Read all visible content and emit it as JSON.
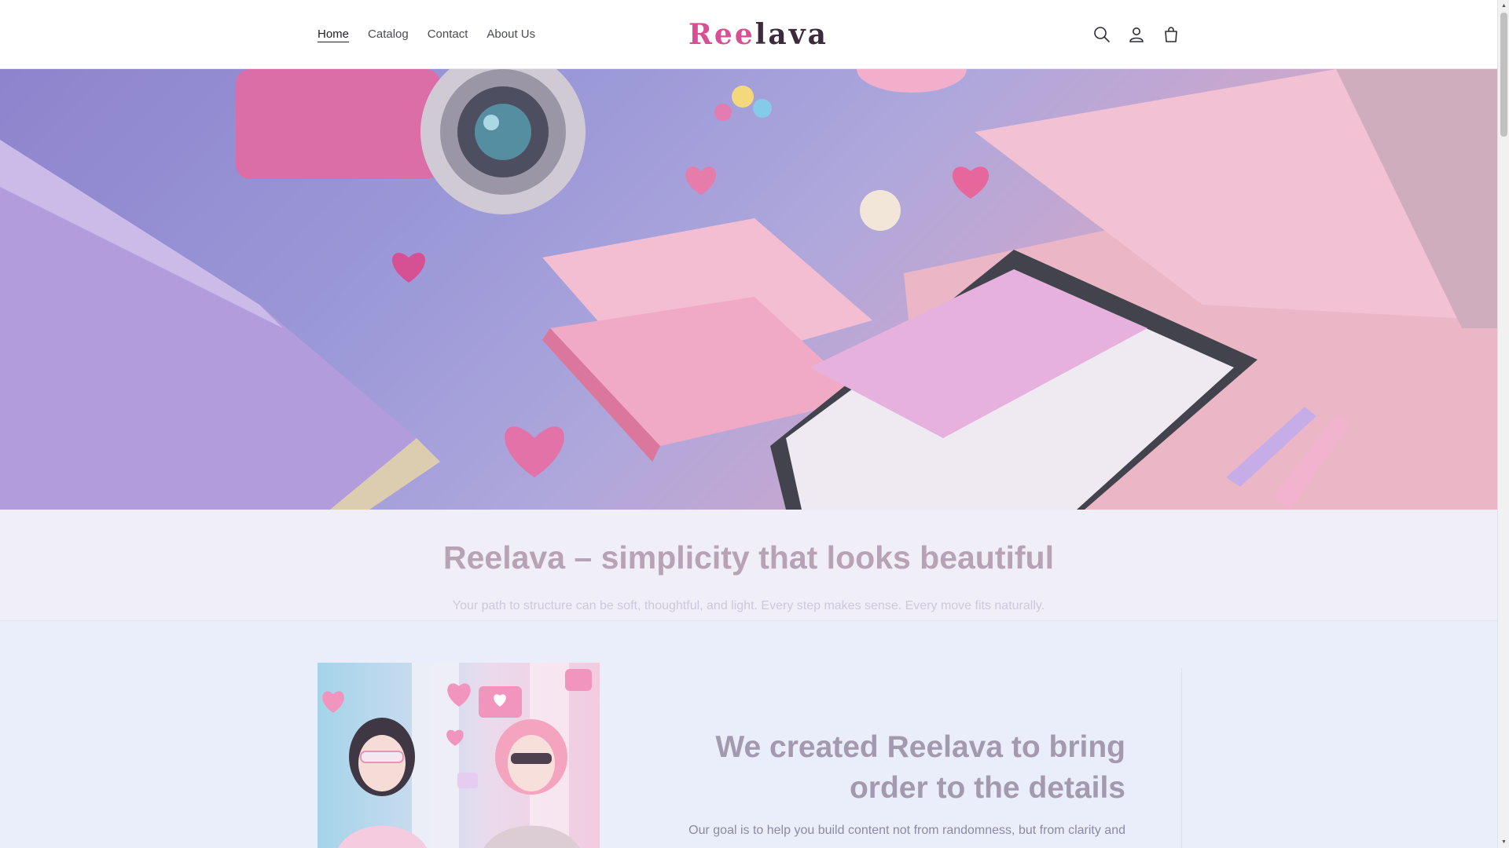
{
  "header": {
    "nav": [
      {
        "label": "Home",
        "active": true
      },
      {
        "label": "Catalog"
      },
      {
        "label": "Contact"
      },
      {
        "label": "About Us"
      }
    ],
    "logo_first": "Ree",
    "logo_second": "lava",
    "icons": [
      "search-icon",
      "account-icon",
      "cart-icon"
    ]
  },
  "intro": {
    "title": "Reelava – simplicity that looks beautiful",
    "text": "Your path to structure can be soft, thoughtful, and light. Every step makes sense. Every move fits naturally."
  },
  "about": {
    "title": "We created Reelava to bring order to the details",
    "text": "Our goal is to help you build content not from randomness, but from clarity and"
  },
  "colors": {
    "accent_pink": "#d94f96",
    "logo_dark": "#3d2a3c",
    "intro_bg": "#f0eef7",
    "lower_bg": "#eaeefb"
  }
}
